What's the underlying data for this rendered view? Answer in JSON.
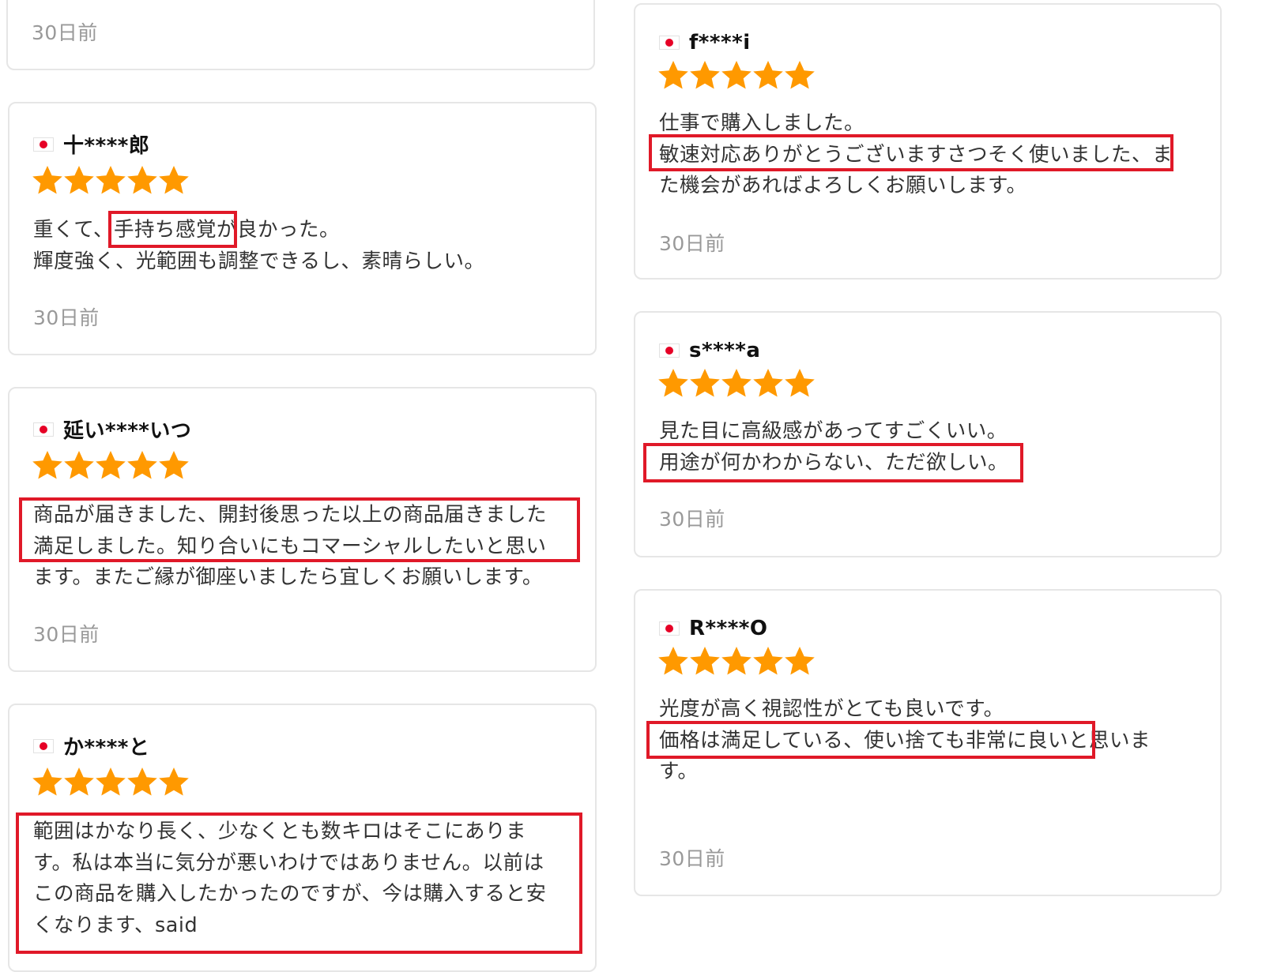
{
  "reviews": [
    {
      "date": "30日前"
    },
    {
      "reviewer": "十****郎",
      "stars": 5,
      "lines": [
        "重くて、手持ち感覚が良かった。",
        "輝度強く、光範囲も調整できるし、素晴らしい。"
      ],
      "date": "30日前"
    },
    {
      "reviewer": "延い****いつ",
      "stars": 5,
      "lines": [
        "商品が届きました、開封後思った以上の商品届きました",
        "満足しました。知り合いにもコマーシャルしたいと思い",
        "ます。またご縁が御座いましたら宜しくお願いします。"
      ],
      "date": "30日前"
    },
    {
      "reviewer": "か****と",
      "stars": 5,
      "lines": [
        "範囲はかなり長く、少なくとも数キロはそこにありま",
        "す。私は本当に気分が悪いわけではありません。以前は",
        "この商品を購入したかったのですが、今は購入すると安",
        "くなります、said"
      ]
    },
    {
      "reviewer": "f****i",
      "stars": 5,
      "lines": [
        "仕事で購入しました。",
        "敏速対応ありがとうございますさつそく使いました、ま",
        "た機会があればよろしくお願いします。"
      ],
      "date": "30日前"
    },
    {
      "reviewer": "s****a",
      "stars": 5,
      "lines": [
        "見た目に高級感があってすごくいい。",
        "用途が何かわからない、ただ欲しい。"
      ],
      "date": "30日前"
    },
    {
      "reviewer": "R****O",
      "stars": 5,
      "lines": [
        "光度が高く視認性がとても良いです。",
        "価格は満足している、使い捨ても非常に良いと思いま",
        "す。"
      ],
      "date": "30日前"
    }
  ],
  "colors": {
    "star": "#ff9900",
    "highlight": "#e01928",
    "flag_red": "#e60026",
    "date": "#999999",
    "card_border": "#e6e6e6"
  },
  "icons": {
    "star": "star-icon",
    "flag": "japan-flag-icon"
  }
}
